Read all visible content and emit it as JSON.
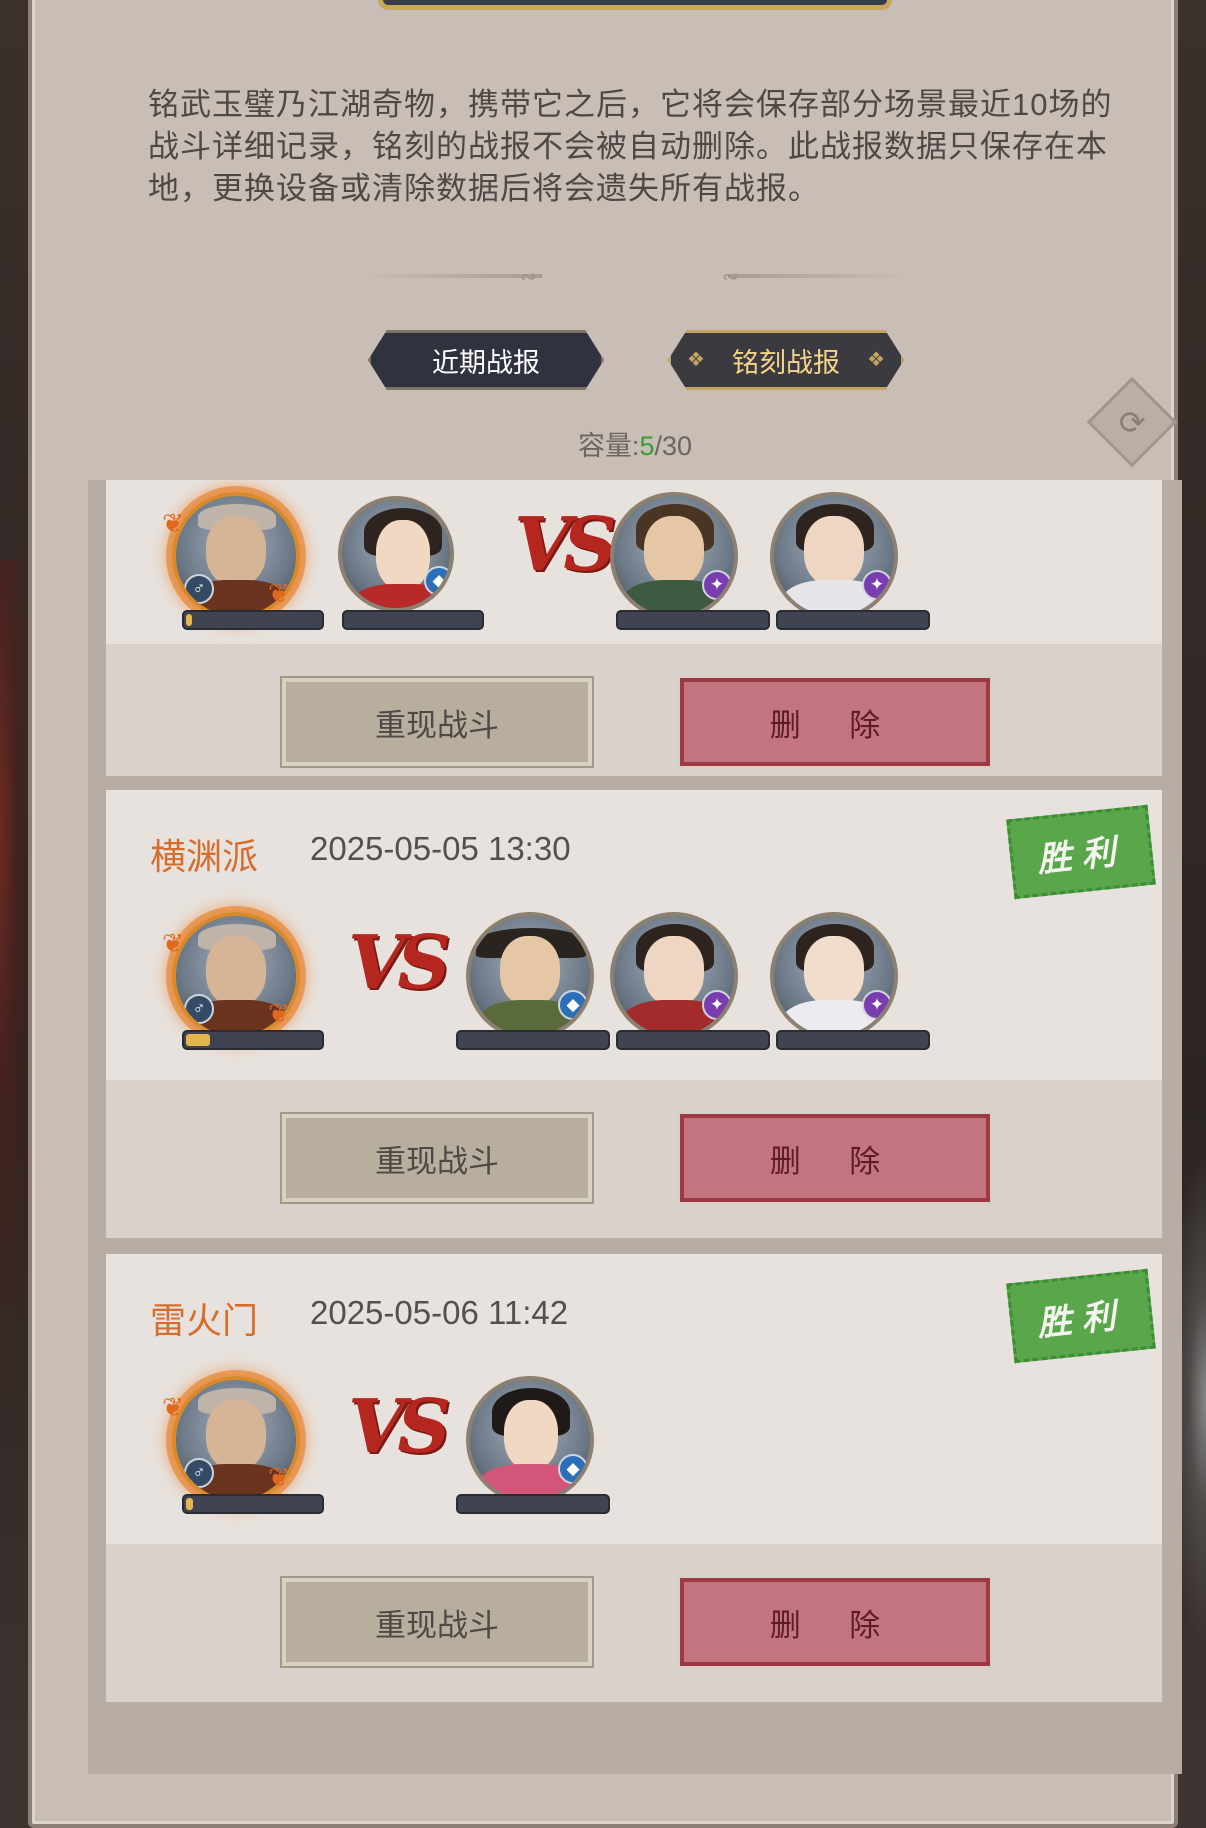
{
  "description": "铭武玉璧乃江湖奇物，携带它之后，它将会保存部分场景最近10场的战斗详细记录，铭刻的战报不会被自动删除。此战报数据只保存在本地，更换设备或清除数据后将会遗失所有战报。",
  "tabs": {
    "recent": "近期战报",
    "carved": "铭刻战报"
  },
  "capacity": {
    "label": "容量:",
    "current": "5",
    "sep": "/",
    "max": "30"
  },
  "icons": {
    "refresh": "refresh-icon",
    "gender": "♂"
  },
  "colors": {
    "clan": "#d76d2c",
    "victory": "#5aa64a",
    "capacity_current": "#3c9a3a"
  },
  "vs_label": "VS",
  "entries": [
    {
      "clan": "",
      "time": "",
      "result": "",
      "replay_label": "重现战斗",
      "delete_label": "删 除",
      "player_hp": 0.04,
      "allies": 1,
      "enemies": 2
    },
    {
      "clan": "横渊派",
      "time": "2025-05-05 13:30",
      "result": "胜利",
      "replay_label": "重现战斗",
      "delete_label": "删 除",
      "player_hp": 0.2,
      "allies": 0,
      "enemies": 3
    },
    {
      "clan": "雷火门",
      "time": "2025-05-06 11:42",
      "result": "胜利",
      "replay_label": "重现战斗",
      "delete_label": "删 除",
      "player_hp": 0.05,
      "allies": 0,
      "enemies": 1
    }
  ]
}
